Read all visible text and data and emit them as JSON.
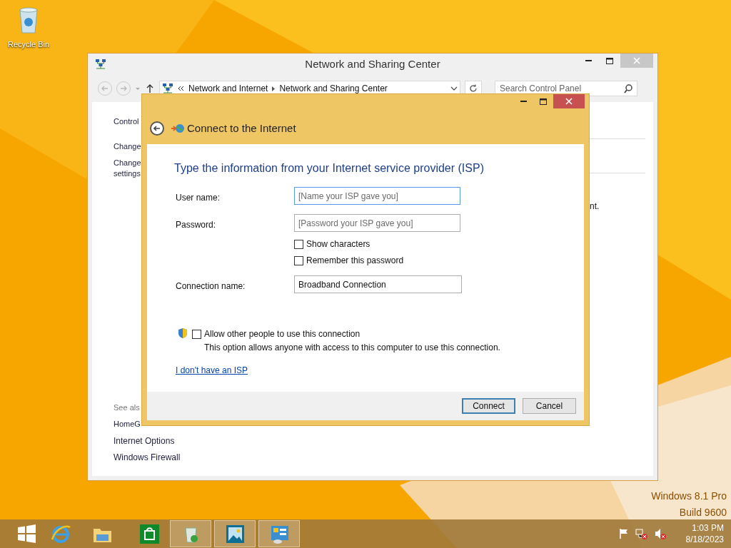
{
  "desktop": {
    "icons": [
      {
        "label": "Recycle Bin"
      }
    ],
    "edition": [
      "Windows 8.1 Pro",
      "Build 9600"
    ]
  },
  "main_window": {
    "title": "Network and Sharing Center",
    "address_bar": {
      "crumbs": [
        "Network and Internet",
        "Network and Sharing Center"
      ]
    },
    "search": {
      "placeholder": "Search Control Panel"
    },
    "left_pane": [
      {
        "text": "Control"
      },
      {
        "text": "Change"
      },
      {
        "text": "Change\nsettings"
      }
    ],
    "see_also": {
      "heading": "See als",
      "links": [
        "HomeG",
        "Internet Options",
        "Windows Firewall"
      ]
    },
    "right_text": "nt."
  },
  "dialog": {
    "title": "Connect to the Internet",
    "heading": "Type the information from your Internet service provider (ISP)",
    "fields": [
      {
        "label": "User name:",
        "placeholder": "[Name your ISP gave you]",
        "focused": true
      },
      {
        "label": "Password:",
        "placeholder": "[Password your ISP gave you]",
        "focused": false
      }
    ],
    "checkboxes": [
      {
        "label": "Show characters",
        "checked": false
      },
      {
        "label": "Remember this password",
        "checked": false
      }
    ],
    "connection_name": {
      "label": "Connection name:",
      "value": "Broadband Connection"
    },
    "allow": {
      "label": "Allow other people to use this connection",
      "checked": false,
      "description": "This option allows anyone with access to this computer to use this connection."
    },
    "link": "I don't have an ISP",
    "buttons": [
      {
        "label": "Connect",
        "default": true
      },
      {
        "label": "Cancel",
        "default": false
      }
    ]
  },
  "taskbar": {
    "apps": [
      {
        "kind": "start",
        "open": false
      },
      {
        "kind": "browser",
        "open": false
      },
      {
        "kind": "folder",
        "open": false
      },
      {
        "kind": "store",
        "open": false
      },
      {
        "kind": "recycle",
        "open": true
      },
      {
        "kind": "photo",
        "open": true
      },
      {
        "kind": "control",
        "open": true
      }
    ],
    "clock": {
      "time": "1:03 PM",
      "date": "8/18/2023"
    }
  }
}
